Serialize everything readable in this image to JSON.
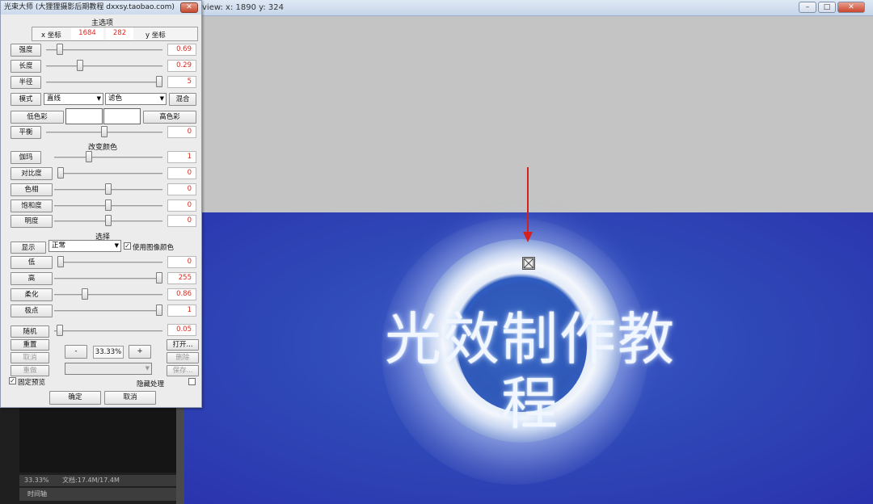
{
  "host": {
    "view_info": "view:  x: 1890  y: 324",
    "min": "–",
    "max": "□",
    "close": "✕"
  },
  "ps": {
    "zoom": "33.33%",
    "doc": "文档:17.4M/17.4M",
    "timeline": "时间轴"
  },
  "canvas": {
    "title_text": "光效制作教程"
  },
  "dialog": {
    "title": "光束大师 (大狸狸摄影后期教程 dxxsy.taobao.com)",
    "close": "✕",
    "main_options": "主选项",
    "x_label": "x 坐标",
    "y_label": "y 坐标",
    "x_value": "1684",
    "y_value": "282",
    "rows": {
      "intensity": {
        "label": "强度",
        "value": "0.69",
        "level": 0.12
      },
      "length": {
        "label": "长度",
        "value": "0.29",
        "level": 0.29
      },
      "radius": {
        "label": "半径",
        "value": "5",
        "level": 0.98
      }
    },
    "mode_label": "模式",
    "mode_value": "直线",
    "filter_value": "滤色",
    "blend_label": "混合",
    "low_color": "低色彩",
    "high_color": "高色彩",
    "balance": {
      "label": "平衡",
      "value": "0",
      "level": 0.5
    },
    "change_color": "改变颜色",
    "gamma": {
      "label": "伽玛",
      "value": "1",
      "level": 0.32
    },
    "contrast": {
      "label": "对比度",
      "value": "0",
      "level": 0.0
    },
    "hue": {
      "label": "色相",
      "value": "0",
      "level": 0.5
    },
    "saturation": {
      "label": "饱和度",
      "value": "0",
      "level": 0.5
    },
    "brightness": {
      "label": "明度",
      "value": "0",
      "level": 0.5
    },
    "select_title": "选择",
    "display_label": "显示",
    "display_value": "正常",
    "use_image_color": "使用图像颜色",
    "use_image_color_checked": "✓",
    "low": {
      "label": "低",
      "value": "0",
      "level": 0.0
    },
    "high": {
      "label": "高",
      "value": "255",
      "level": 1.0
    },
    "soften": {
      "label": "柔化",
      "value": "0.86",
      "level": 0.28
    },
    "pole": {
      "label": "极点",
      "value": "1",
      "level": 1.0
    },
    "random": {
      "label": "随机",
      "value": "0.05",
      "level": 0.05
    },
    "reset": "重置",
    "cancel_small": "取消",
    "redo": "重做",
    "minus": "-",
    "zoom_value": "33.33%",
    "plus": "+",
    "open": "打开...",
    "delete": "删除",
    "save": "保存...",
    "fixed_preview": "固定预览",
    "fixed_preview_checked": "✓",
    "hide_processing": "隐藏处理",
    "ok": "确定",
    "cancel": "取消"
  }
}
